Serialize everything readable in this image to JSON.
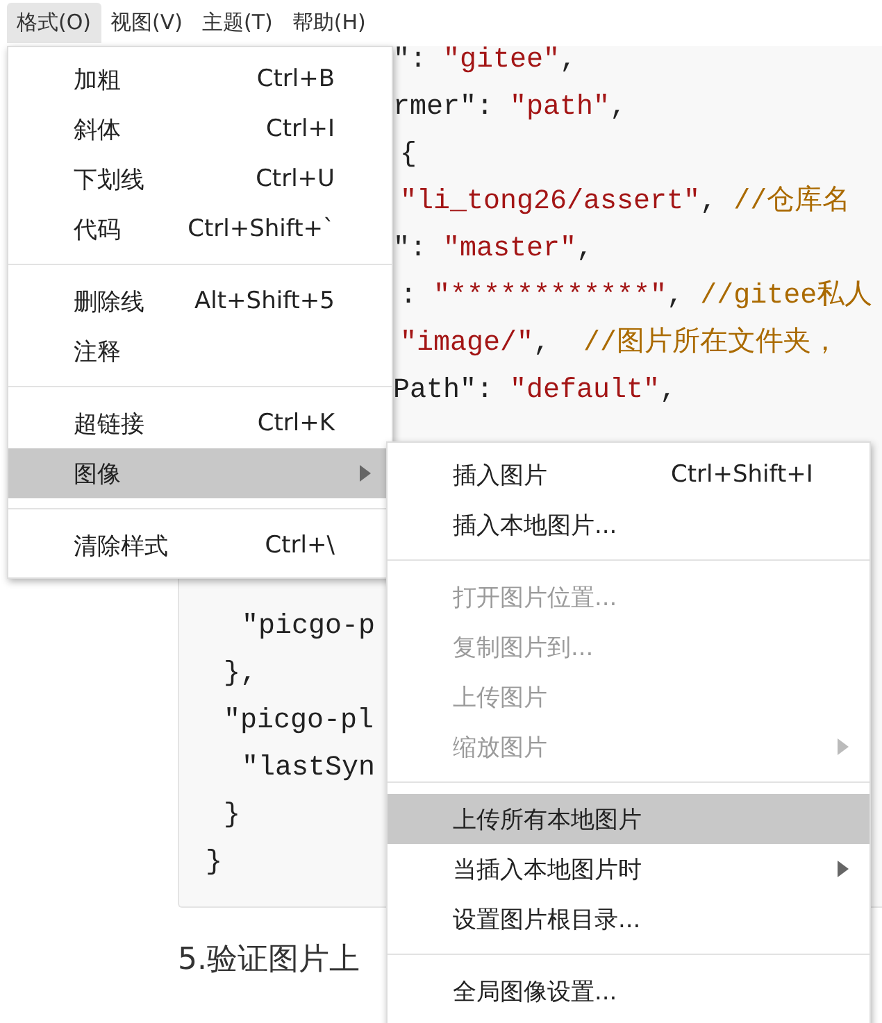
{
  "menubar": [
    {
      "label": "格式(O)",
      "selected": true
    },
    {
      "label": "视图(V)",
      "selected": false
    },
    {
      "label": "主题(T)",
      "selected": false
    },
    {
      "label": "帮助(H)",
      "selected": false
    }
  ],
  "code_lines": [
    [
      {
        "kind": "key",
        "text": "\": "
      },
      {
        "kind": "string",
        "text": "\"gitee\""
      },
      {
        "kind": "punct",
        "text": ","
      }
    ],
    [
      {
        "kind": "key",
        "text": "rmer\": "
      },
      {
        "kind": "string",
        "text": "\"path\""
      },
      {
        "kind": "punct",
        "text": ","
      }
    ],
    [
      {
        "kind": "punct",
        "text": "{"
      }
    ],
    [
      {
        "kind": "string",
        "text": "\"li_tong26/assert\""
      },
      {
        "kind": "punct",
        "text": ", "
      },
      {
        "kind": "comment",
        "text": "//仓库名"
      }
    ],
    [
      {
        "kind": "key",
        "text": "\": "
      },
      {
        "kind": "string",
        "text": "\"master\""
      },
      {
        "kind": "punct",
        "text": ","
      }
    ],
    [
      {
        "kind": "key",
        "text": ": "
      },
      {
        "kind": "string",
        "text": "\"************\""
      },
      {
        "kind": "punct",
        "text": ", "
      },
      {
        "kind": "comment",
        "text": "//gitee私人"
      }
    ],
    [
      {
        "kind": "string",
        "text": "\"image/\""
      },
      {
        "kind": "punct",
        "text": ",  "
      },
      {
        "kind": "comment",
        "text": "//图片所在文件夹，"
      }
    ],
    [
      {
        "kind": "key",
        "text": "Path\": "
      },
      {
        "kind": "string",
        "text": "\"default\""
      },
      {
        "kind": "punct",
        "text": ","
      }
    ],
    [
      {
        "kind": "key",
        "text": "\"picgo-p"
      }
    ],
    [
      {
        "kind": "punct",
        "text": "},"
      }
    ],
    [
      {
        "kind": "key",
        "text": "\"picgo-pl"
      }
    ],
    [
      {
        "kind": "key",
        "text": "\"lastSyn"
      }
    ],
    [
      {
        "kind": "punct",
        "text": "}"
      }
    ],
    [
      {
        "kind": "punct",
        "text": "}"
      }
    ]
  ],
  "heading": "5.验证图片上",
  "format_menu": [
    {
      "kind": "item",
      "label": "加粗",
      "shortcut": "Ctrl+B",
      "selected": false,
      "disabled": false,
      "submenu": false
    },
    {
      "kind": "item",
      "label": "斜体",
      "shortcut": "Ctrl+I",
      "selected": false,
      "disabled": false,
      "submenu": false
    },
    {
      "kind": "item",
      "label": "下划线",
      "shortcut": "Ctrl+U",
      "selected": false,
      "disabled": false,
      "submenu": false
    },
    {
      "kind": "item",
      "label": "代码",
      "shortcut": "Ctrl+Shift+`",
      "selected": false,
      "disabled": false,
      "submenu": false
    },
    {
      "kind": "separator"
    },
    {
      "kind": "item",
      "label": "删除线",
      "shortcut": "Alt+Shift+5",
      "selected": false,
      "disabled": false,
      "submenu": false
    },
    {
      "kind": "item",
      "label": "注释",
      "selected": false,
      "disabled": false,
      "submenu": false
    },
    {
      "kind": "separator"
    },
    {
      "kind": "item",
      "label": "超链接",
      "shortcut": "Ctrl+K",
      "selected": false,
      "disabled": false,
      "submenu": false
    },
    {
      "kind": "item",
      "label": "图像",
      "selected": true,
      "disabled": false,
      "submenu": true
    },
    {
      "kind": "separator"
    },
    {
      "kind": "item",
      "label": "清除样式",
      "shortcut": "Ctrl+\\",
      "selected": false,
      "disabled": false,
      "submenu": false
    }
  ],
  "image_menu": [
    {
      "kind": "item",
      "label": "插入图片",
      "shortcut": "Ctrl+Shift+I",
      "selected": false,
      "disabled": false,
      "submenu": false
    },
    {
      "kind": "item",
      "label": "插入本地图片...",
      "selected": false,
      "disabled": false,
      "submenu": false
    },
    {
      "kind": "separator"
    },
    {
      "kind": "item",
      "label": "打开图片位置...",
      "selected": false,
      "disabled": true,
      "submenu": false
    },
    {
      "kind": "item",
      "label": "复制图片到...",
      "selected": false,
      "disabled": true,
      "submenu": false
    },
    {
      "kind": "item",
      "label": "上传图片",
      "selected": false,
      "disabled": true,
      "submenu": false
    },
    {
      "kind": "item",
      "label": "缩放图片",
      "selected": false,
      "disabled": true,
      "submenu": true
    },
    {
      "kind": "separator"
    },
    {
      "kind": "item",
      "label": "上传所有本地图片",
      "selected": true,
      "disabled": false,
      "submenu": false
    },
    {
      "kind": "item",
      "label": "当插入本地图片时",
      "selected": false,
      "disabled": false,
      "submenu": true
    },
    {
      "kind": "item",
      "label": "设置图片根目录...",
      "selected": false,
      "disabled": false,
      "submenu": false
    },
    {
      "kind": "separator"
    },
    {
      "kind": "item",
      "label": "全局图像设置...",
      "selected": false,
      "disabled": false,
      "submenu": false
    }
  ]
}
